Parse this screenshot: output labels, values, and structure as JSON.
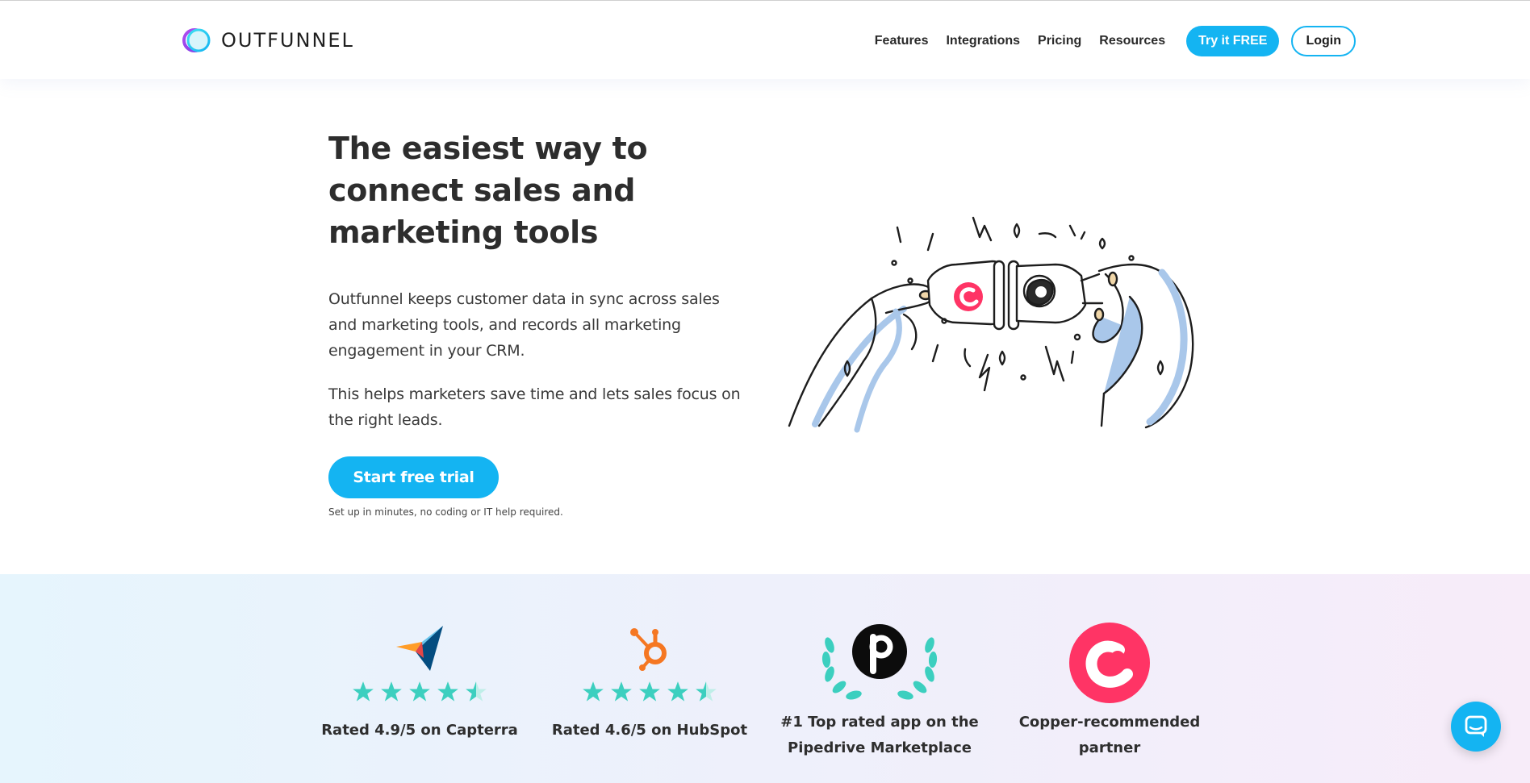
{
  "brand": {
    "name": "OUTFUNNEL",
    "accent": "#14b4f2"
  },
  "nav": {
    "items": [
      "Features",
      "Integrations",
      "Pricing",
      "Resources"
    ],
    "cta_label": "Try it FREE",
    "login_label": "Login"
  },
  "hero": {
    "title_line1": "The easiest way to",
    "title_line2": "connect sales and",
    "title_line3": "marketing tools",
    "paragraph1": "Outfunnel keeps customer data in sync across sales and marketing tools, and records all marketing engagement in your CRM.",
    "paragraph2": "This helps marketers save time and lets sales focus on the right leads.",
    "cta_label": "Start free trial",
    "note": "Set up in minutes, no coding or IT help required."
  },
  "ratings": [
    {
      "logo": "capterra-icon",
      "score": 4.9,
      "label": "Rated 4.9/5 on Capterra"
    },
    {
      "logo": "hubspot-icon",
      "score": 4.6,
      "label": "Rated 4.6/5 on HubSpot"
    },
    {
      "logo": "pipedrive-laurel-icon",
      "label_line1": "#1 Top rated app on the",
      "label_line2": "Pipedrive Marketplace"
    },
    {
      "logo": "copper-icon",
      "label_line1": "Copper-recommended",
      "label_line2": "partner"
    }
  ],
  "colors": {
    "star": "#3ccfbf",
    "copper": "#ff3465",
    "hubspot": "#f57722",
    "illustration_blue": "#a9c7ea"
  },
  "chat": {
    "icon": "chat-bubble-icon"
  }
}
